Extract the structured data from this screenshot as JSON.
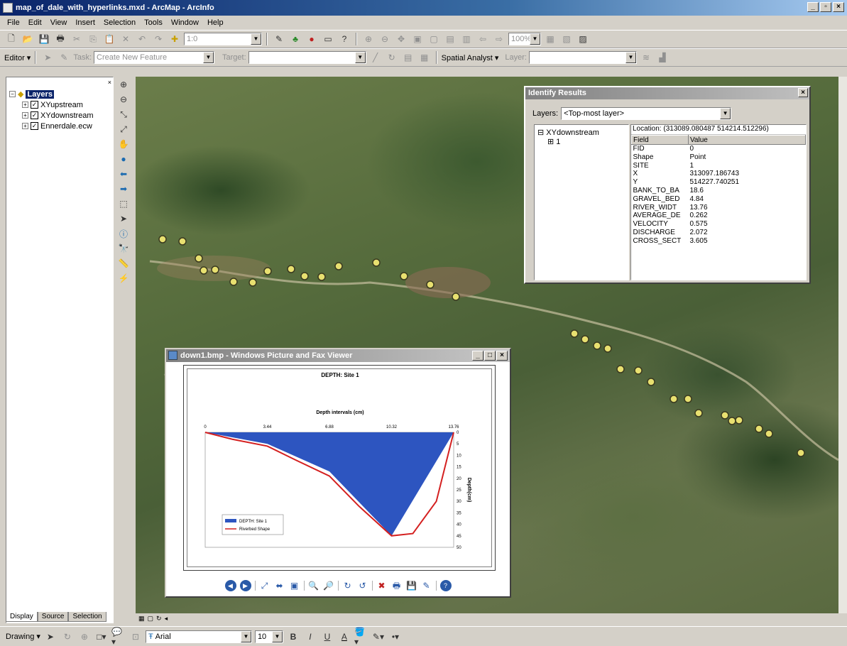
{
  "window": {
    "title": "map_of_dale_with_hyperlinks.mxd - ArcMap - ArcInfo"
  },
  "menu": [
    "File",
    "Edit",
    "View",
    "Insert",
    "Selection",
    "Tools",
    "Window",
    "Help"
  ],
  "standard_toolbar": {
    "scale_value": "1:0",
    "zoom_percent": "100%"
  },
  "editor_toolbar": {
    "editor_label": "Editor",
    "task_label": "Task:",
    "task_value": "Create New Feature",
    "target_label": "Target:",
    "target_value": "",
    "spatial_analyst_label": "Spatial Analyst",
    "layer_label": "Layer:",
    "layer_value": ""
  },
  "toc": {
    "root": "Layers",
    "layers": [
      {
        "name": "XYupstream",
        "checked": true
      },
      {
        "name": "XYdownstream",
        "checked": true
      },
      {
        "name": "Ennerdale.ecw",
        "checked": true
      }
    ],
    "tabs": [
      "Display",
      "Source",
      "Selection"
    ]
  },
  "identify": {
    "title": "Identify Results",
    "layers_label": "Layers:",
    "layers_value": "<Top-most layer>",
    "tree_layer": "XYdownstream",
    "tree_feature": "1",
    "location": "Location: (313089.080487 514214.512296)",
    "columns": [
      "Field",
      "Value"
    ],
    "rows": [
      [
        "FID",
        "0"
      ],
      [
        "Shape",
        "Point"
      ],
      [
        "SITE",
        "1"
      ],
      [
        "X",
        "313097.186743"
      ],
      [
        "Y",
        "514227.740251"
      ],
      [
        "BANK_TO_BA",
        "18.6"
      ],
      [
        "GRAVEL_BED",
        "4.84"
      ],
      [
        "RIVER_WIDT",
        "13.76"
      ],
      [
        "AVERAGE_DE",
        "0.262"
      ],
      [
        "VELOCITY",
        "0.575"
      ],
      [
        "DISCHARGE",
        "2.072"
      ],
      [
        "CROSS_SECT",
        "3.605"
      ]
    ]
  },
  "viewer": {
    "title": "down1.bmp - Windows Picture and Fax Viewer"
  },
  "chart_data": {
    "type": "area",
    "title": "DEPTH: Site 1",
    "xlabel": "Depth intervals (cm)",
    "ylabel": "Depth(cm)",
    "x_ticks": [
      "0",
      "3.44",
      "6.88",
      "10.32",
      "13.76"
    ],
    "y_ticks": [
      "0",
      "5",
      "10",
      "15",
      "20",
      "25",
      "30",
      "35",
      "40",
      "45",
      "50"
    ],
    "ylim": [
      0,
      50
    ],
    "series": [
      {
        "name": "DEPTH: Site 1",
        "x": [
          0,
          3.44,
          6.88,
          10.32,
          13.76
        ],
        "values": [
          0,
          5,
          17,
          45,
          0
        ]
      },
      {
        "name": "Riverbed Shape",
        "x": [
          0,
          1.5,
          3.44,
          5.0,
          6.88,
          8.5,
          10.32,
          11.5,
          12.8,
          13.76
        ],
        "values": [
          0,
          3,
          6,
          12,
          19,
          32,
          45,
          44,
          30,
          0
        ]
      }
    ],
    "legend": "bottom-left"
  },
  "drawing": {
    "label": "Drawing",
    "font": "Arial",
    "size": "10",
    "bold": "B",
    "italic": "I",
    "underline": "U",
    "text_a": "A"
  },
  "colors": {
    "area_fill": "#2d55c0",
    "riverbed_line": "#d42020",
    "point_fill": "#e8e070"
  }
}
